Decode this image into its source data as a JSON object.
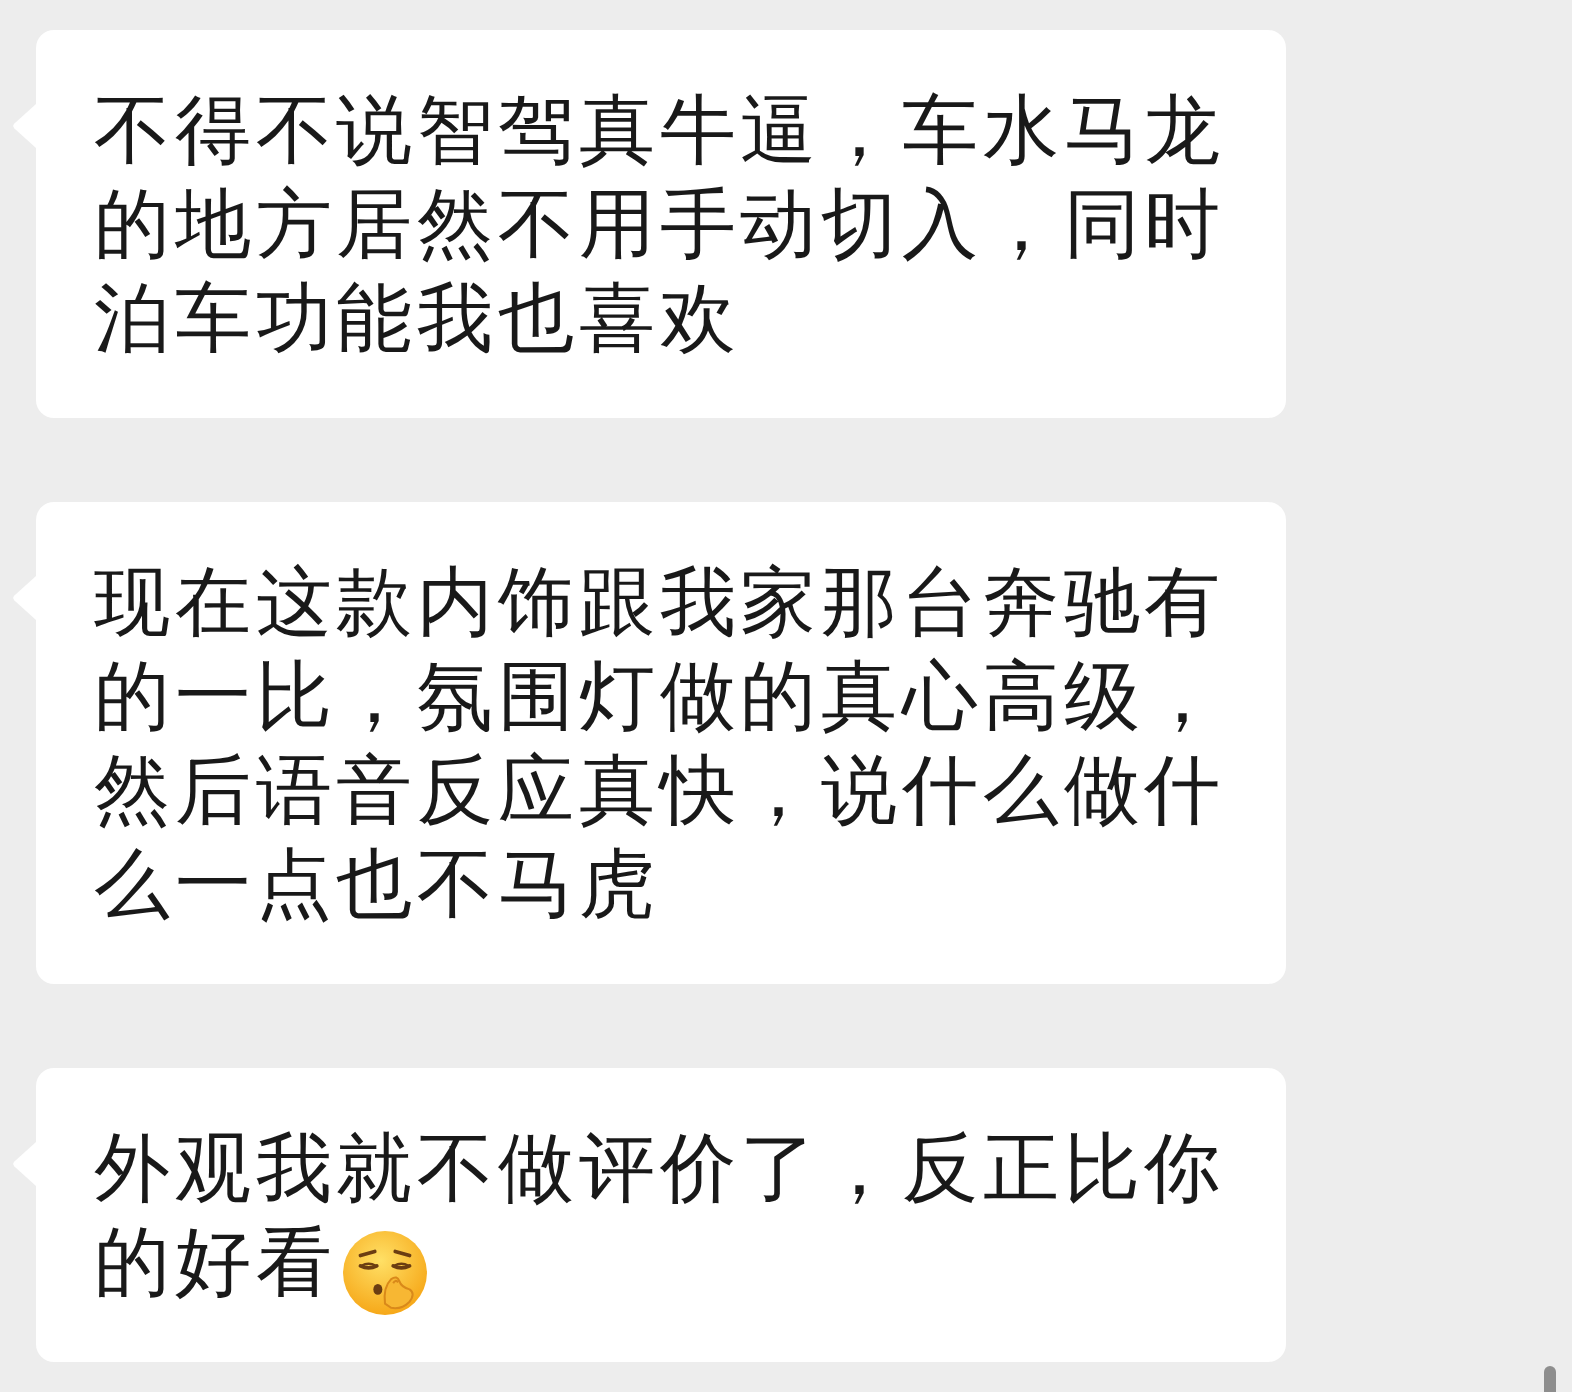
{
  "messages": [
    {
      "text": "不得不说智驾真牛逼，车水马龙的地方居然不用手动切入，同时泊车功能我也喜欢",
      "trailing_emoji": false
    },
    {
      "text": "现在这款内饰跟我家那台奔驰有的一比，氛围灯做的真心高级，然后语音反应真快，说什么做什么一点也不马虎",
      "trailing_emoji": false
    },
    {
      "text": "外观我就不做评价了，反正比你的好看",
      "trailing_emoji": true
    }
  ]
}
